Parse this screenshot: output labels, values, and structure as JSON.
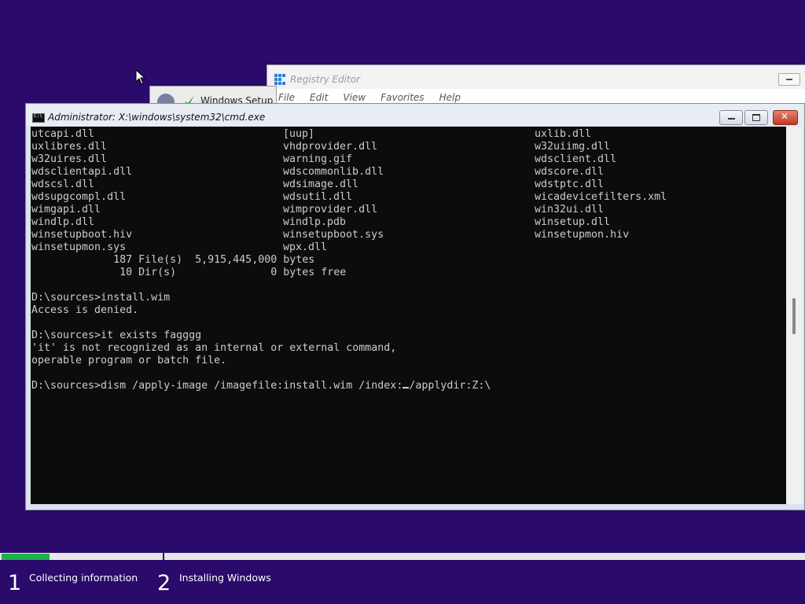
{
  "registry_editor": {
    "title": "Registry Editor",
    "menu": [
      "File",
      "Edit",
      "View",
      "Favorites",
      "Help"
    ]
  },
  "windows_setup": {
    "title": "Windows Setup"
  },
  "cmd": {
    "title": "Administrator: X:\\windows\\system32\\cmd.exe",
    "rows": [
      [
        "utcapi.dll",
        "[uup]",
        "uxlib.dll"
      ],
      [
        "uxlibres.dll",
        "vhdprovider.dll",
        "w32uiimg.dll"
      ],
      [
        "w32uires.dll",
        "warning.gif",
        "wdsclient.dll"
      ],
      [
        "wdsclientapi.dll",
        "wdscommonlib.dll",
        "wdscore.dll"
      ],
      [
        "wdscsl.dll",
        "wdsimage.dll",
        "wdstptc.dll"
      ],
      [
        "wdsupgcompl.dll",
        "wdsutil.dll",
        "wicadevicefilters.xml"
      ],
      [
        "wimgapi.dll",
        "wimprovider.dll",
        "win32ui.dll"
      ],
      [
        "windlp.dll",
        "windlp.pdb",
        "winsetup.dll"
      ],
      [
        "winsetupboot.hiv",
        "winsetupboot.sys",
        "winsetupmon.hiv"
      ],
      [
        "winsetupmon.sys",
        "wpx.dll",
        ""
      ]
    ],
    "summary": [
      "             187 File(s)  5,915,445,000 bytes",
      "              10 Dir(s)               0 bytes free"
    ],
    "session": [
      "",
      "D:\\sources>install.wim",
      "Access is denied.",
      "",
      "D:\\sources>it exists fagggg",
      "'it' is not recognized as an internal or external command,",
      "operable program or batch file.",
      ""
    ],
    "current_command_before_cursor": "D:\\sources>dism /apply-image /imagefile:install.wim /index:",
    "current_command_after_cursor": "/applydir:Z:\\"
  },
  "setup_progress": {
    "progress_fraction": 0.06,
    "steps": [
      {
        "number": "1",
        "label": "Collecting information"
      },
      {
        "number": "2",
        "label": "Installing Windows"
      }
    ]
  },
  "colors": {
    "background": "#2a0a6b",
    "progress": "#1db04a",
    "console_bg": "#0c0c0c",
    "console_text": "#cccccc"
  }
}
